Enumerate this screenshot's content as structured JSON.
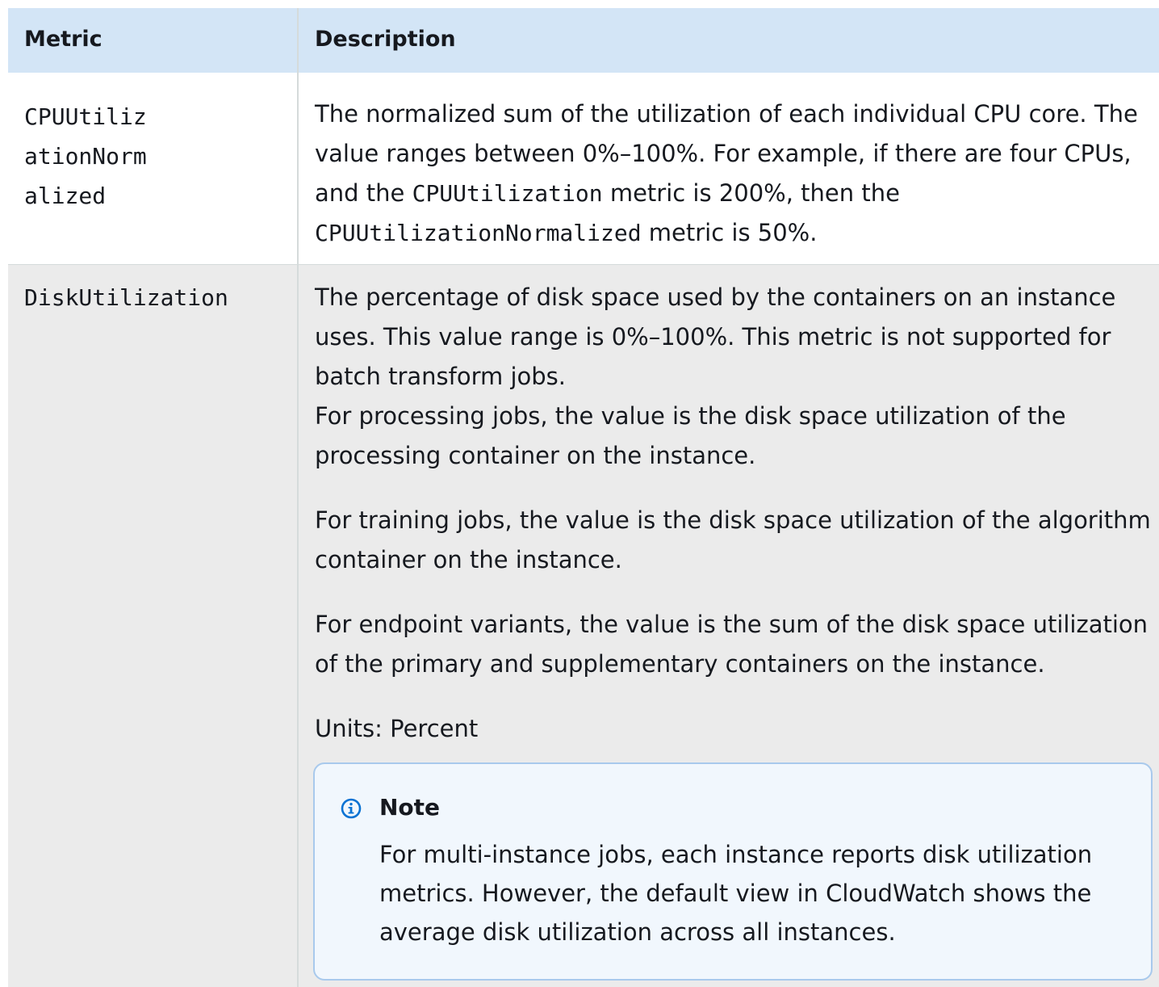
{
  "table": {
    "headers": {
      "metric": "Metric",
      "description": "Description"
    },
    "rows": [
      {
        "metric_lines": [
          "CPUUtiliz",
          "ationNorm",
          "alized"
        ],
        "description": {
          "t1": "The normalized sum of the utilization of each individual CPU core. The value ranges between 0%–100%. For example, if there are four CPUs, and the ",
          "c1": "CPUUtilization",
          "t2": " metric is 200%, then the ",
          "c2": "CPUUtilizationNormalized",
          "t3": " metric is 50%."
        }
      },
      {
        "metric": "DiskUtilization",
        "paragraphs": [
          "The percentage of disk space used by the containers on an instance uses. This value range is 0%–100%. This metric is not supported for batch transform jobs.",
          "For processing jobs, the value is the disk space utilization of the processing container on the instance.",
          "For training jobs, the value is the disk space utilization of the algorithm container on the instance.",
          "For endpoint variants, the value is the sum of the disk space utilization of the primary and supplementary containers on the instance.",
          "Units: Percent"
        ],
        "note": {
          "icon": "info-icon",
          "title": "Note",
          "body": "For multi-instance jobs, each instance reports disk utilization metrics. However, the default view in CloudWatch shows the average disk utilization across all instances."
        }
      }
    ]
  },
  "colors": {
    "header_bg": "#d3e5f6",
    "row_alt_bg": "#ebebeb",
    "note_bg": "#f1f7fd",
    "note_border": "#a8c9ec",
    "info_icon": "#0972d3"
  }
}
